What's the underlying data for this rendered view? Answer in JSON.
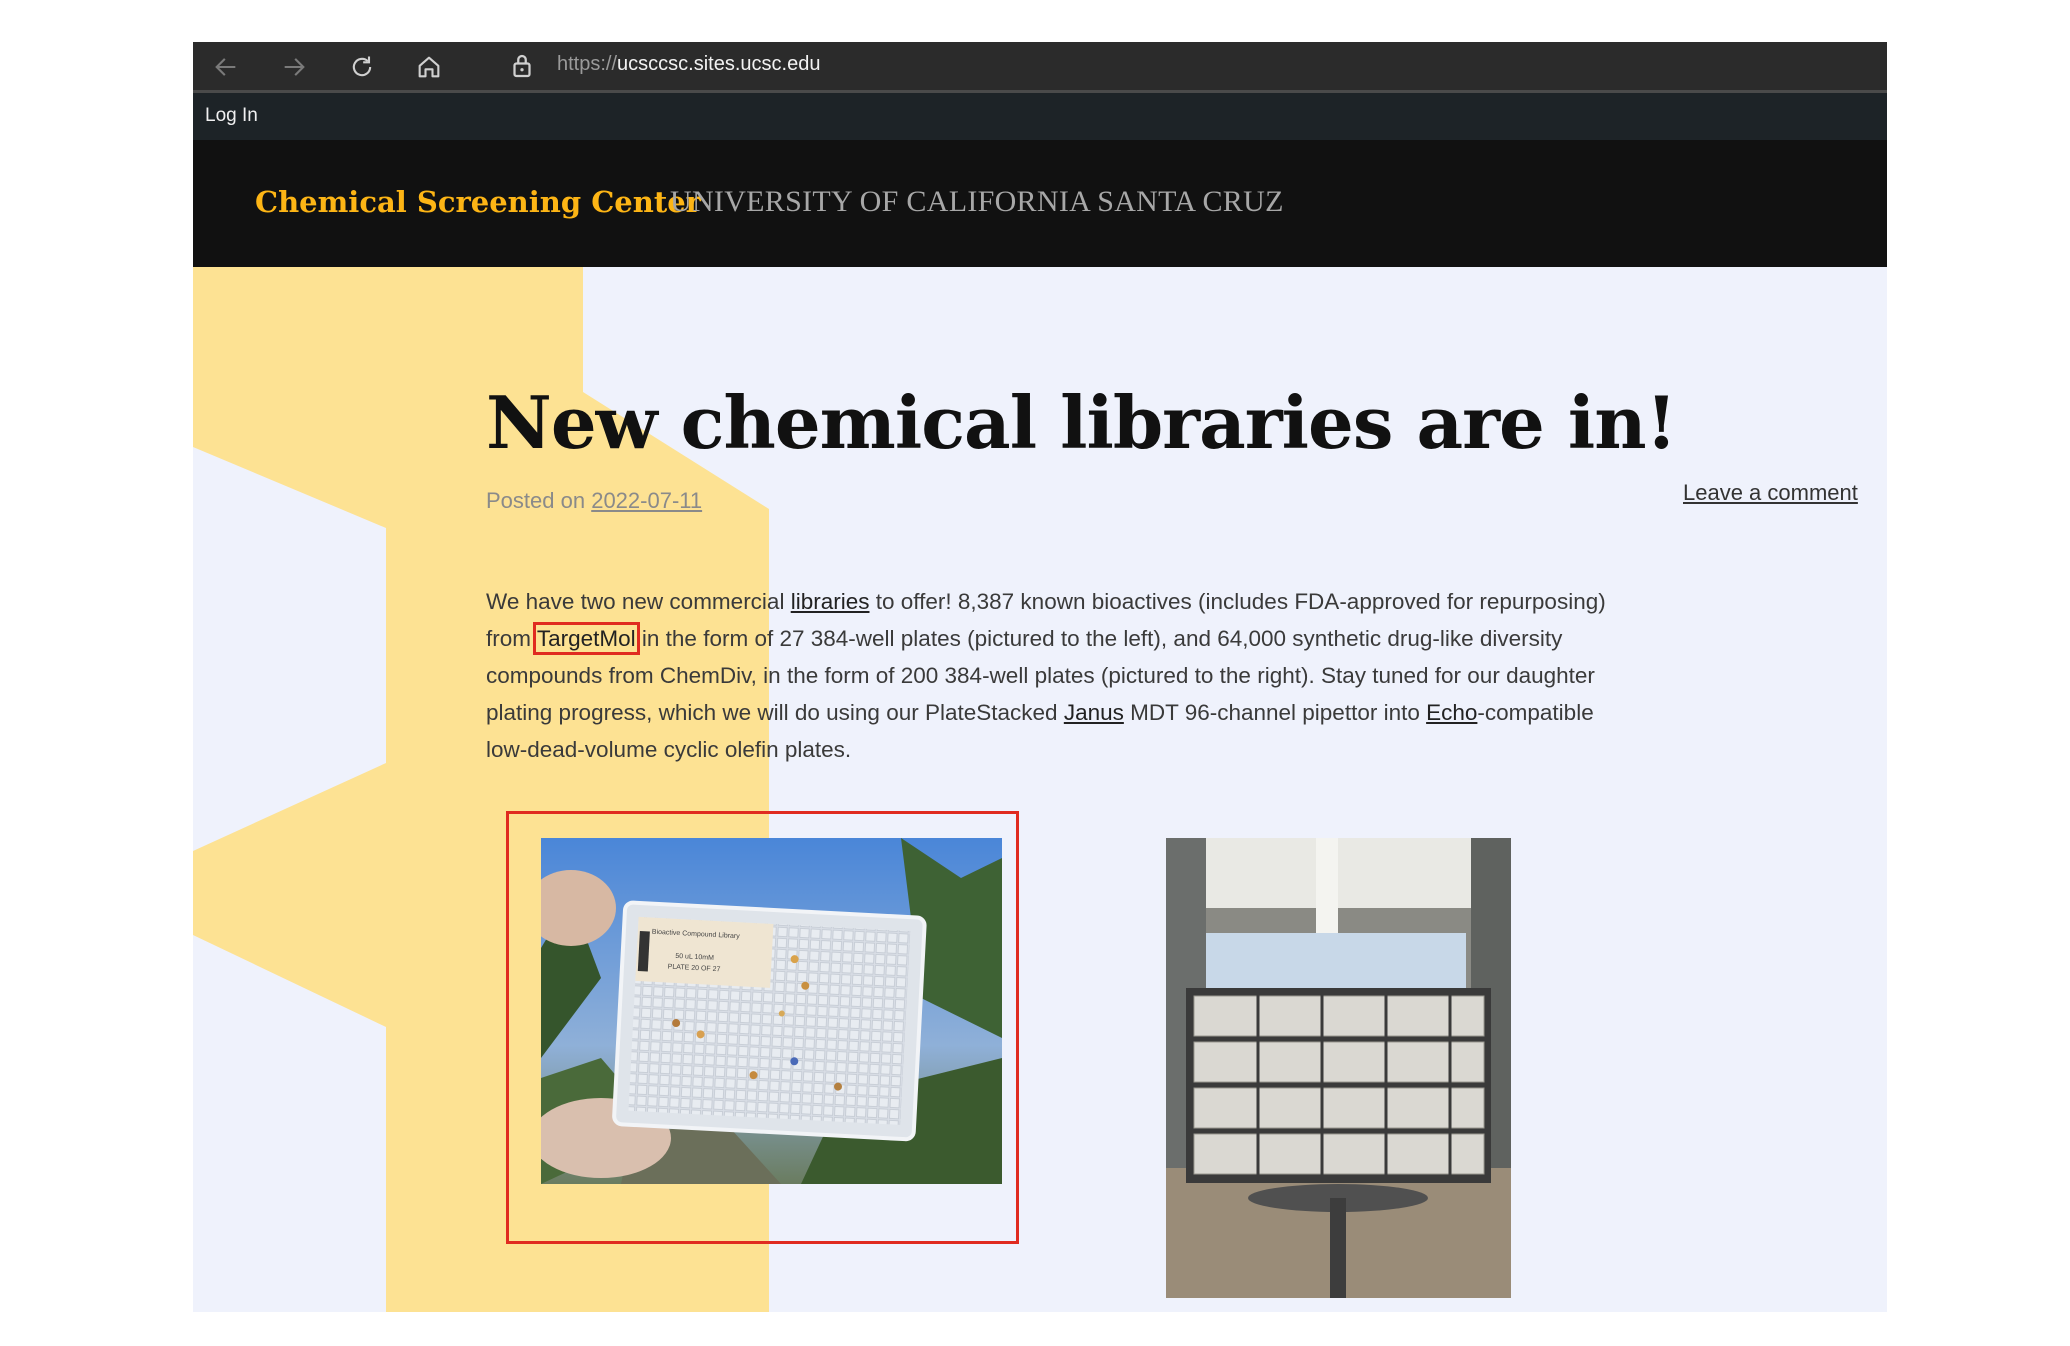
{
  "browser": {
    "url_scheme": "https://",
    "url_host": "ucsccsc.sites.ucsc.edu"
  },
  "adminbar": {
    "login_label": "Log In"
  },
  "site": {
    "title": "Chemical Screening Center",
    "description": "UNIVERSITY OF CALIFORNIA SANTA CRUZ"
  },
  "post": {
    "title": "New chemical libraries are in!",
    "posted_on_label": "Posted on",
    "date": "2022-07-11",
    "leave_comment": "Leave a comment",
    "body": {
      "p1": "We have two new commercial ",
      "link_libraries": "libraries",
      "p2": " to offer! 8,387 known bioactives (includes FDA-approved for repurposing) from ",
      "link_targetmol": "TargetMol",
      "p3": " in the form of 27 384-well plates (pictured to the left), and 64,000 synthetic drug-like diversity compounds from ChemDiv, in the form of 200 384-well plates (pictured to the right). Stay tuned for our daughter plating progress, which we will do using our PlateStacked ",
      "link_janus": "Janus",
      "p4": " MDT 96-channel pipettor into ",
      "link_echo": "Echo",
      "p5": "-compatible low-dead-volume cyclic olefin plates."
    },
    "images": {
      "left_label_title": "Bioactive Compound Library",
      "left_label_line1": "50 uL 10mM",
      "left_label_line2": "PLATE 20 OF 27"
    }
  },
  "colors": {
    "accent_gold": "#fdb515",
    "shape_yellow": "#fde293",
    "page_bg": "#eff2fc",
    "highlight_red": "#e02b20"
  }
}
